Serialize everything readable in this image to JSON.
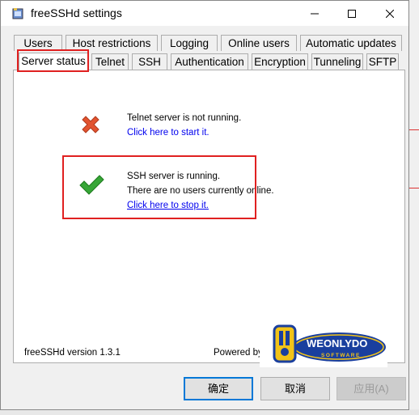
{
  "window": {
    "title": "freeSSHd settings",
    "controls": {
      "minimize": "minimize",
      "maximize": "maximize",
      "close": "close"
    }
  },
  "tabs_row1": [
    "Users",
    "Host restrictions",
    "Logging",
    "Online users",
    "Automatic updates"
  ],
  "tabs_row2": [
    "Server status",
    "Telnet",
    "SSH",
    "Authentication",
    "Encryption",
    "Tunneling",
    "SFTP"
  ],
  "active_tab": "Server status",
  "telnet": {
    "status": "Telnet server is not running.",
    "action": "Click here to start it.",
    "icon": "red-x-icon",
    "color": "#e04a2a"
  },
  "ssh": {
    "status": "SSH server is running.",
    "users": "There are no users currently online.",
    "action": "Click here to stop it.",
    "icon": "green-check-icon",
    "color": "#2f9e2f"
  },
  "footer": {
    "version": "freeSSHd version 1.3.1",
    "powered_by": "Powered by",
    "logo_text": "WEONLYDO",
    "logo_subtext": "SOFTWARE"
  },
  "buttons": {
    "ok": "确定",
    "cancel": "取消",
    "apply": "应用(A)"
  },
  "colors": {
    "highlight": "#e02020",
    "link": "#0000ee"
  }
}
